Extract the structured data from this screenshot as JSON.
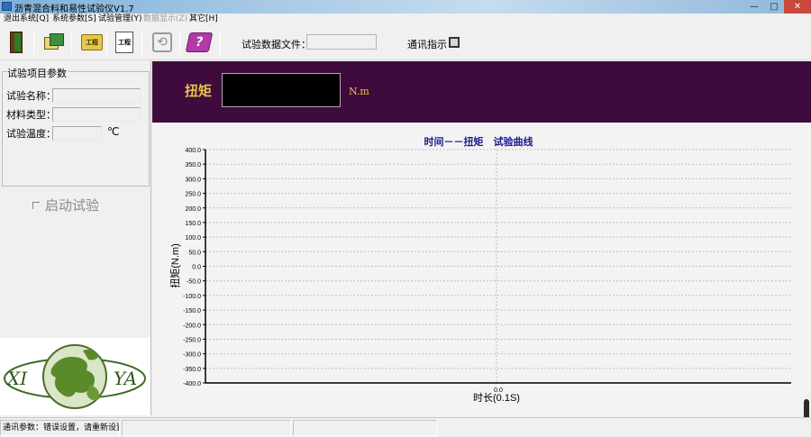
{
  "window": {
    "title": "沥青混合料和易性试验仪V1.7",
    "min": "—",
    "max": "□",
    "close": "✕"
  },
  "menu": [
    {
      "label": "退出系统[Q]",
      "enabled": true
    },
    {
      "label": "系统参数[S]",
      "enabled": true
    },
    {
      "label": "试验管理(Y)",
      "enabled": true
    },
    {
      "label": "数据显示(Z)",
      "enabled": false
    },
    {
      "label": "其它[H]",
      "enabled": true
    }
  ],
  "toolbar": {
    "buttons": [
      {
        "name": "exit-icon"
      },
      {
        "name": "params-icon"
      },
      {
        "name": "folder-icon",
        "text": "工程"
      },
      {
        "name": "page-icon",
        "text": "工程"
      },
      {
        "name": "refresh-icon",
        "glyph": "⟲"
      },
      {
        "name": "help-icon",
        "glyph": "?"
      }
    ],
    "data_file_label": "试验数据文件：",
    "data_file_value": "",
    "comm_label": "通讯指示"
  },
  "params": {
    "legend": "试验项目参数",
    "name_label": "试验名称：",
    "name_value": "",
    "material_label": "材料类型：",
    "material_value": "",
    "temp_label": "试验温度：",
    "temp_value": "",
    "temp_unit": "℃"
  },
  "start": {
    "label": "启动试验",
    "checked": false
  },
  "logo": {
    "left": "XI",
    "right": "YA"
  },
  "torque": {
    "label": "扭矩",
    "value": "",
    "unit": "N.m"
  },
  "chart_data": {
    "type": "line",
    "title": "时间－－扭矩　试验曲线",
    "xlabel": "时长(0.1S)",
    "ylabel": "扭矩(N.m)",
    "ylim": [
      -400,
      400
    ],
    "y_ticks": [
      "400.0",
      "350.0",
      "300.0",
      "250.0",
      "200.0",
      "150.0",
      "100.0",
      "50.0",
      "0.0",
      "-50.0",
      "-100.0",
      "-150.0",
      "-200.0",
      "-250.0",
      "-300.0",
      "-350.0",
      "-400.0"
    ],
    "x_ticks": [
      "0.0"
    ],
    "grid": true,
    "series": []
  },
  "status": {
    "message": "通讯参数：错误设置，请重新设置!",
    "cell2": "",
    "cell3": ""
  },
  "colors": {
    "header_bg": "#3f0b3c",
    "accent": "#e8c34a",
    "chart_title": "#1a1a8c"
  }
}
